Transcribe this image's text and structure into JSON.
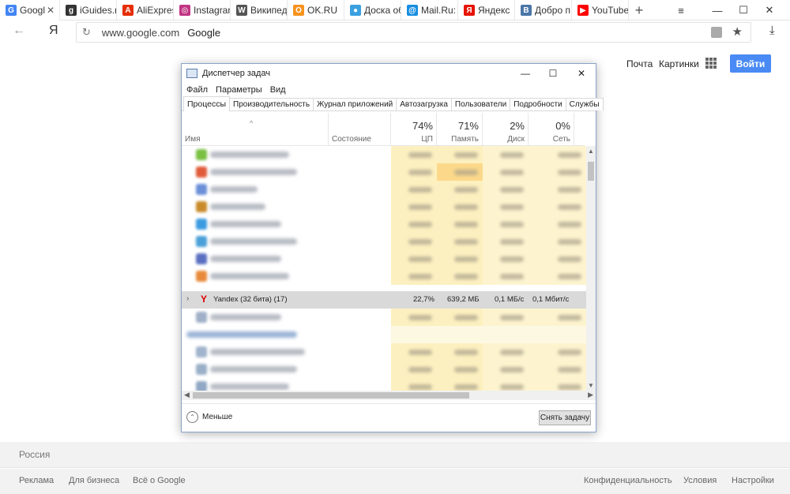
{
  "browser": {
    "tabs": [
      {
        "title": "Googl",
        "favicon_color": "#4285f4",
        "favicon_glyph": "G",
        "active": true
      },
      {
        "title": "iGuides.r",
        "favicon_color": "#333333",
        "favicon_glyph": "g"
      },
      {
        "title": "AliExpres",
        "favicon_color": "#e62e04",
        "favicon_glyph": "A"
      },
      {
        "title": "Instagran",
        "favicon_color": "#c13584",
        "favicon_glyph": "◎"
      },
      {
        "title": "Википед",
        "favicon_color": "#555555",
        "favicon_glyph": "W"
      },
      {
        "title": "OK.RU",
        "favicon_color": "#f7931e",
        "favicon_glyph": "О"
      },
      {
        "title": "Доска об",
        "favicon_color": "#3aa0e0",
        "favicon_glyph": "●"
      },
      {
        "title": "Mail.Ru: r",
        "favicon_color": "#168de2",
        "favicon_glyph": "@"
      },
      {
        "title": "Яндекс",
        "favicon_color": "#e61400",
        "favicon_glyph": "Я"
      },
      {
        "title": "Добро п",
        "favicon_color": "#4a76a8",
        "favicon_glyph": "В"
      },
      {
        "title": "YouTube",
        "favicon_color": "#ff0000",
        "favicon_glyph": "▶"
      }
    ],
    "address": {
      "host": "www.google.com",
      "title": "Google",
      "yandex_btn": "Я"
    }
  },
  "google": {
    "mail": "Почта",
    "images": "Картинки",
    "signin": "Войти",
    "country": "Россия",
    "footer_left": [
      "Реклама",
      "Для бизнеса",
      "Всё о Google"
    ],
    "footer_right": [
      "Конфиденциальность",
      "Условия",
      "Настройки"
    ]
  },
  "taskmanager": {
    "title": "Диспетчер задач",
    "menu": [
      "Файл",
      "Параметры",
      "Вид"
    ],
    "tabs": [
      "Процессы",
      "Производительность",
      "Журнал приложений",
      "Автозагрузка",
      "Пользователи",
      "Подробности",
      "Службы"
    ],
    "columns": {
      "name": "Имя",
      "status": "Состояние",
      "cpu": {
        "label": "ЦП",
        "pct": "74%"
      },
      "memory": {
        "label": "Память",
        "pct": "71%"
      },
      "disk": {
        "label": "Диск",
        "pct": "2%"
      },
      "network": {
        "label": "Сеть",
        "pct": "0%"
      }
    },
    "highlighted_row": {
      "name": "Yandex (32 бита) (17)",
      "cpu": "22,7%",
      "memory": "639,2 МБ",
      "disk": "0,1 МБ/с",
      "network": "0,1 Мбит/с"
    },
    "fewer": "Меньше",
    "end_task": "Снять задачу"
  }
}
